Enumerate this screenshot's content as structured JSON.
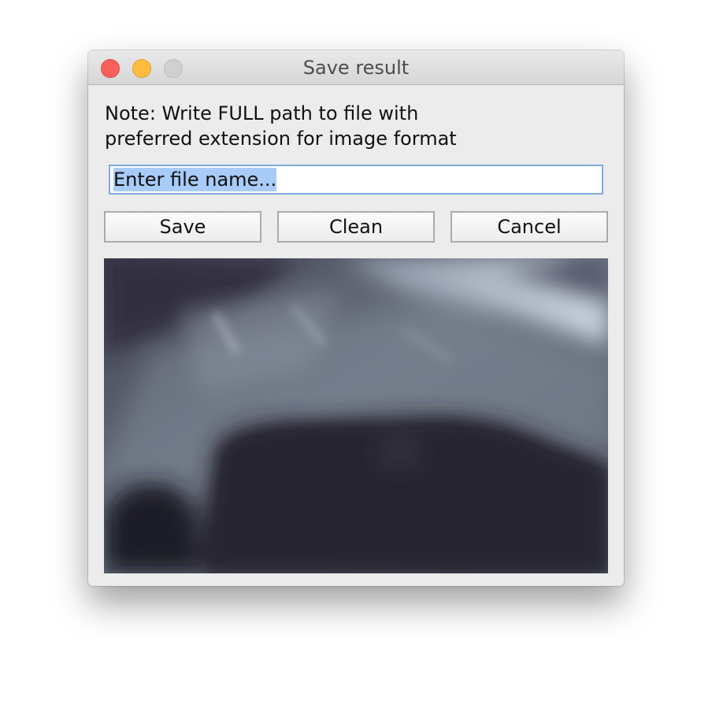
{
  "window": {
    "title": "Save result"
  },
  "note": {
    "line1": "Note: Write FULL path to file with",
    "line2": "preferred extension for image format"
  },
  "file_input": {
    "value": "Enter file name..."
  },
  "buttons": {
    "save": "Save",
    "clean": "Clean",
    "cancel": "Cancel"
  },
  "colors": {
    "close": "#fc605c",
    "minimize": "#fdbc40",
    "maximize_disabled": "#d0d0d0",
    "input_focus_border": "#7fa9df",
    "selection": "#a8cbf7"
  }
}
